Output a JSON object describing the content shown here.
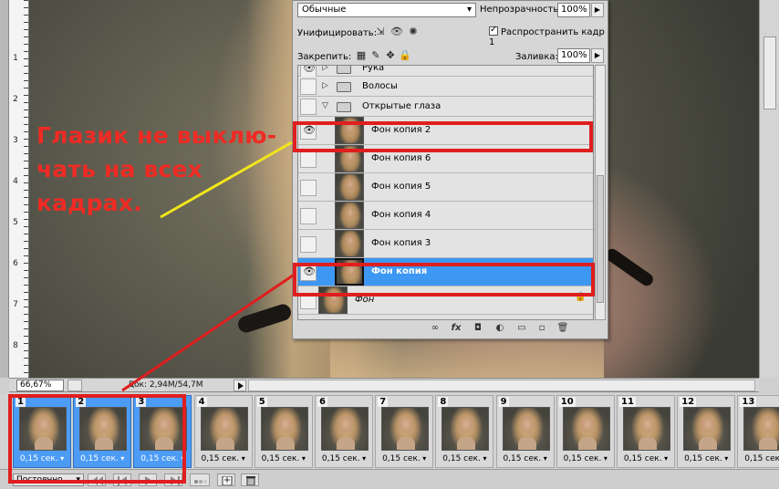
{
  "layers_panel": {
    "blend_mode": "Обычные",
    "opacity_label": "Непрозрачность:",
    "opacity_value": "100%",
    "unify_label": "Унифицировать:",
    "propagate_label": "Распространить кадр 1",
    "lock_label": "Закрепить:",
    "fill_label": "Заливка:",
    "fill_value": "100%",
    "layers": [
      {
        "name": "Рука",
        "type": "group",
        "visible": true,
        "expanded": false
      },
      {
        "name": "Волосы",
        "type": "group",
        "visible": false,
        "expanded": false
      },
      {
        "name": "Открытые глаза",
        "type": "group",
        "visible": false,
        "expanded": true
      },
      {
        "name": "Фон копия 2",
        "type": "layer",
        "visible": true,
        "selected": false
      },
      {
        "name": "Фон копия 6",
        "type": "layer",
        "visible": false,
        "selected": false
      },
      {
        "name": "Фон копия 5",
        "type": "layer",
        "visible": false,
        "selected": false
      },
      {
        "name": "Фон копия 4",
        "type": "layer",
        "visible": false,
        "selected": false
      },
      {
        "name": "Фон копия 3",
        "type": "layer",
        "visible": false,
        "selected": false
      },
      {
        "name": "Фон копия",
        "type": "layer",
        "visible": true,
        "selected": true
      },
      {
        "name": "Фон",
        "type": "background",
        "visible": false,
        "locked": true
      }
    ],
    "footer_icons": [
      "link-icon",
      "fx-icon",
      "mask-icon",
      "adjustment-icon",
      "group-folder-icon",
      "new-layer-icon",
      "trash-icon"
    ]
  },
  "status_bar": {
    "zoom": "66,67%",
    "doc_size": "Док: 2,94M/54,7M"
  },
  "timeline": {
    "frames": [
      {
        "number": "1",
        "delay": "0,15 сек.",
        "selected": true
      },
      {
        "number": "2",
        "delay": "0,15 сек.",
        "selected": true
      },
      {
        "number": "3",
        "delay": "0,15 сек.",
        "selected": true
      },
      {
        "number": "4",
        "delay": "0,15 сек.",
        "selected": false
      },
      {
        "number": "5",
        "delay": "0,15 сек.",
        "selected": false
      },
      {
        "number": "6",
        "delay": "0,15 сек.",
        "selected": false
      },
      {
        "number": "7",
        "delay": "0,15 сек.",
        "selected": false
      },
      {
        "number": "8",
        "delay": "0,15 сек.",
        "selected": false
      },
      {
        "number": "9",
        "delay": "0,15 сек.",
        "selected": false
      },
      {
        "number": "10",
        "delay": "0,15 сек.",
        "selected": false
      },
      {
        "number": "11",
        "delay": "0,15 сек.",
        "selected": false
      },
      {
        "number": "12",
        "delay": "0,15 сек.",
        "selected": false
      },
      {
        "number": "13",
        "delay": "0,15 сек.",
        "selected": false
      }
    ],
    "loop": "Постоянно"
  },
  "ruler_numbers": [
    "1",
    "2",
    "3",
    "4",
    "5",
    "6",
    "7",
    "8"
  ],
  "annotation": {
    "lines": [
      "Глазик не выклю-",
      "чать на всех",
      "кадрах."
    ],
    "color": "#ee2b24"
  },
  "colors": {
    "selection_blue": "#3d98f4",
    "annotation_red": "#e01e1e",
    "arrow_yellow": "#f2e61c"
  }
}
